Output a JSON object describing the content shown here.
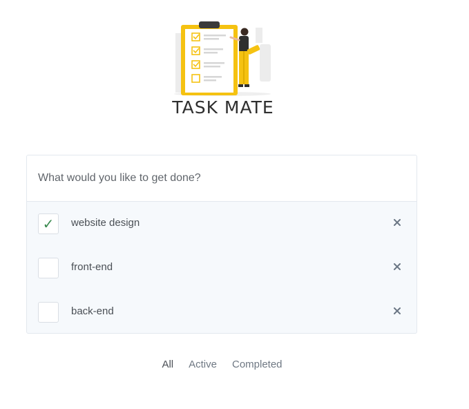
{
  "app": {
    "logo_text": "TASK MATE",
    "accent_color": "#f5c211"
  },
  "input": {
    "placeholder": "What would you like to get done?",
    "value": ""
  },
  "tasks": [
    {
      "label": "website design",
      "completed": true
    },
    {
      "label": "front-end",
      "completed": false
    },
    {
      "label": "back-end",
      "completed": false
    }
  ],
  "icons": {
    "check": "checkmark-icon",
    "delete": "close-icon"
  },
  "filters": [
    {
      "label": "All",
      "selected": true
    },
    {
      "label": "Active",
      "selected": false
    },
    {
      "label": "Completed",
      "selected": false
    }
  ]
}
